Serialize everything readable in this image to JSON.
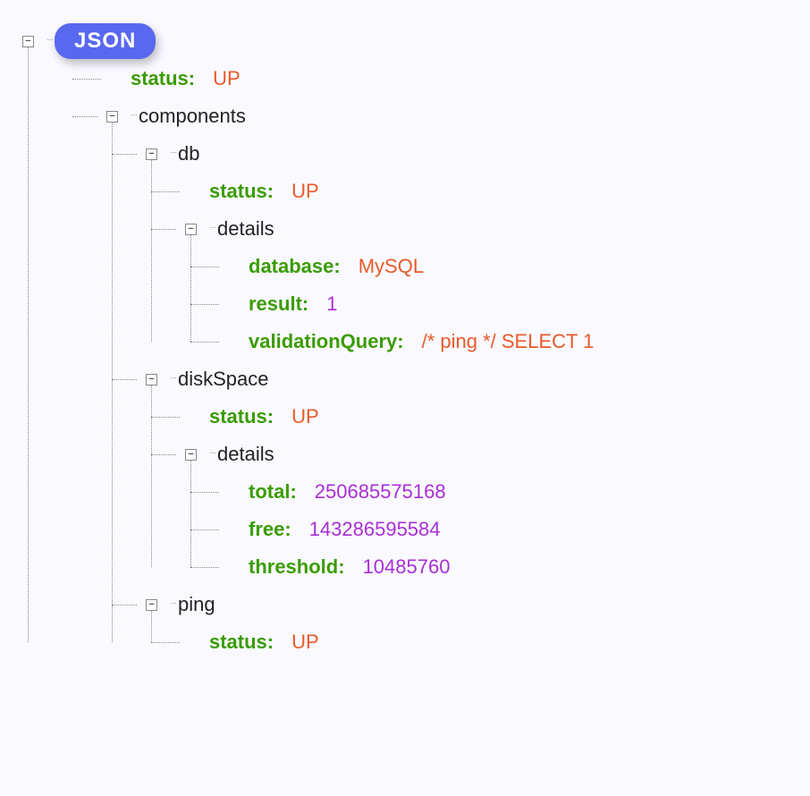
{
  "root_label": "JSON",
  "status_key": "status",
  "status_val": "UP",
  "components_key": "components",
  "db": {
    "key": "db",
    "status_key": "status",
    "status_val": "UP",
    "details_key": "details",
    "database_key": "database",
    "database_val": "MySQL",
    "result_key": "result",
    "result_val": "1",
    "validationQuery_key": "validationQuery",
    "validationQuery_val": "/* ping */ SELECT 1"
  },
  "diskSpace": {
    "key": "diskSpace",
    "status_key": "status",
    "status_val": "UP",
    "details_key": "details",
    "total_key": "total",
    "total_val": "250685575168",
    "free_key": "free",
    "free_val": "143286595584",
    "threshold_key": "threshold",
    "threshold_val": "10485760"
  },
  "ping": {
    "key": "ping",
    "status_key": "status",
    "status_val": "UP"
  }
}
